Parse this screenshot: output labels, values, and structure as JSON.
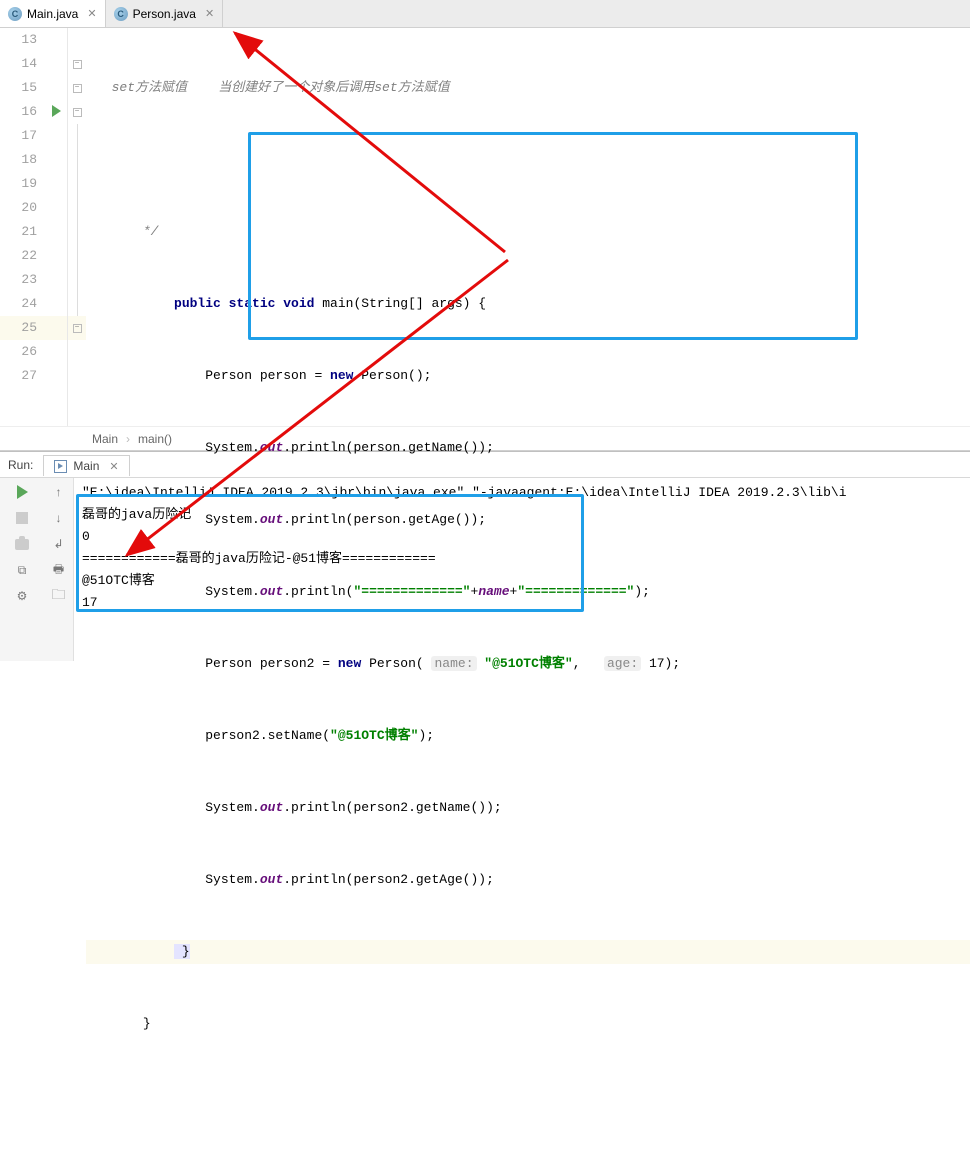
{
  "tabs": [
    {
      "label": "Main.java",
      "active": true
    },
    {
      "label": "Person.java",
      "active": false
    }
  ],
  "gutter": {
    "start": 13,
    "end": 27,
    "highlight": 25,
    "run_icon_line": 16
  },
  "code": {
    "l13": "set方法赋值    当创建好了一个对象后调用set方法赋值",
    "l15": "*/",
    "l16_pre": "public static void",
    "l16_fn": " main",
    "l16_args": "(String[] args) {",
    "l17_a": "        Person person = ",
    "l17_b": "new",
    "l17_c": " Person();",
    "l18_a": "        System.",
    "l18_b": "out",
    "l18_c": ".println(person.getName());",
    "l19_a": "        System.",
    "l19_b": "out",
    "l19_c": ".println(person.getAge());",
    "l20_a": "        System.",
    "l20_b": "out",
    "l20_c": ".println(",
    "l20_s1": "\"=============\"",
    "l20_d": "+",
    "l20_v": "name",
    "l20_e": "+",
    "l20_s2": "\"=============\"",
    "l20_f": ");",
    "l21_a": "        Person person2 = ",
    "l21_b": "new",
    "l21_c": " Person( ",
    "l21_h1": "name:",
    "l21_s1": " \"@51OTC博客\"",
    "l21_d": ",   ",
    "l21_h2": "age:",
    "l21_e": " 17);",
    "l22_a": "        person2.setName(",
    "l22_s": "\"@51OTC博客\"",
    "l22_b": ");",
    "l23_a": "        System.",
    "l23_b": "out",
    "l23_c": ".println(person2.getName());",
    "l24_a": "        System.",
    "l24_b": "out",
    "l24_c": ".println(person2.getAge());",
    "l25": "}",
    "l26": "}"
  },
  "breadcrumbs": [
    "Main",
    "main()"
  ],
  "run": {
    "label": "Run:",
    "tab": "Main",
    "output": [
      "\"E:\\idea\\IntelliJ IDEA 2019.2.3\\jbr\\bin\\java.exe\" \"-javaagent:E:\\idea\\IntelliJ IDEA 2019.2.3\\lib\\i",
      "磊哥的java历险记",
      "0",
      "============磊哥的java历险记-@51博客============",
      "@51OTC博客",
      "17"
    ]
  }
}
